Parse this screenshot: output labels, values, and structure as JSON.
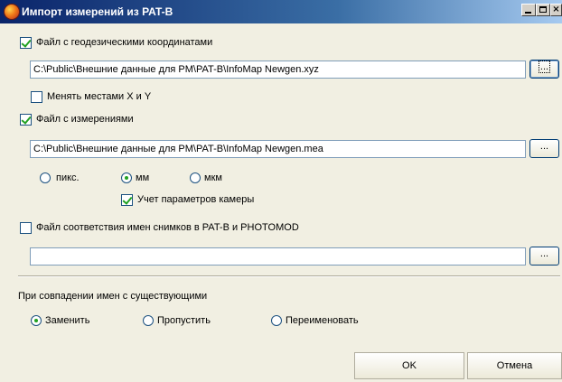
{
  "window": {
    "title": "Импорт измерений из PAT-B"
  },
  "section_xyz": {
    "checkbox_label": "Файл с геодезическими координатами",
    "checked": true,
    "path_value": "C:\\Public\\Внешние данные для PM\\PAT-B\\InfoMap Newgen.xyz",
    "browse_label": "...",
    "swap_xy_label": "Менять местами X и Y",
    "swap_xy_checked": false
  },
  "section_mea": {
    "checkbox_label": "Файл с измерениями",
    "checked": true,
    "path_value": "C:\\Public\\Внешние данные для PM\\PAT-B\\InfoMap Newgen.mea",
    "browse_label": "...",
    "units": [
      {
        "label": "пикс.",
        "selected": false
      },
      {
        "label": "мм",
        "selected": true
      },
      {
        "label": "мкм",
        "selected": false
      }
    ],
    "camera_params_label": "Учет параметров камеры",
    "camera_params_checked": true
  },
  "section_map": {
    "checkbox_label": "Файл соответствия имен снимков в PAT-B и PHOTOMOD",
    "checked": false,
    "path_value": "",
    "browse_label": "..."
  },
  "name_conflict": {
    "heading": "При совпадении имен с существующими",
    "options": [
      {
        "label": "Заменить",
        "selected": true
      },
      {
        "label": "Пропустить",
        "selected": false
      },
      {
        "label": "Переименовать",
        "selected": false
      }
    ]
  },
  "buttons": {
    "ok": "OK",
    "cancel": "Отмена"
  }
}
